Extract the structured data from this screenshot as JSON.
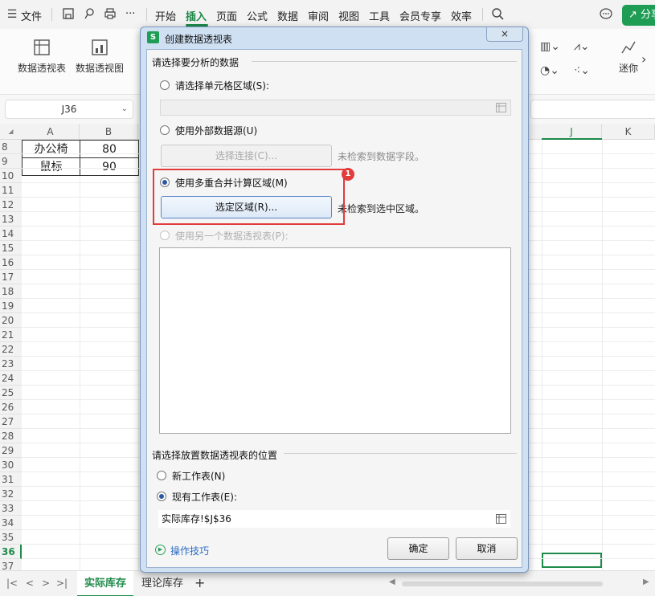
{
  "menubar": {
    "file_label": "文件",
    "more_label": "···",
    "tabs": [
      "开始",
      "插入",
      "页面",
      "公式",
      "数据",
      "审阅",
      "视图",
      "工具",
      "会员专享",
      "效率"
    ],
    "share_label": "分享"
  },
  "ribbon": {
    "pivot_table_label": "数据透视表",
    "pivot_chart_label": "数据透视图",
    "sparkline_label": "迷你"
  },
  "namebox": {
    "value": "J36"
  },
  "grid": {
    "columns": [
      "A",
      "B",
      "J",
      "K"
    ],
    "rows": [
      "8",
      "9",
      "10",
      "11",
      "12",
      "13",
      "14",
      "15",
      "16",
      "17",
      "18",
      "19",
      "20",
      "21",
      "22",
      "23",
      "24",
      "25",
      "26",
      "27",
      "28",
      "29",
      "30",
      "31",
      "32",
      "33",
      "34",
      "35",
      "36",
      "37"
    ],
    "cells": [
      {
        "a": "办公椅",
        "b": "80"
      },
      {
        "a": "鼠标",
        "b": "90"
      }
    ],
    "active_row": "36"
  },
  "sheet_tabs": {
    "active": "实际库存",
    "other": "理论库存",
    "add": "+"
  },
  "dialog": {
    "title": "创建数据透视表",
    "app_icon_letter": "S",
    "close_label": "×",
    "section_source": "请选择要分析的数据",
    "opt_cell_range": "请选择单元格区域(S):",
    "opt_external": "使用外部数据源(U)",
    "btn_choose_connection": "选择连接(C)...",
    "note_no_fields": "未检索到数据字段。",
    "opt_multi_range": "使用多重合并计算区域(M)",
    "btn_select_range": "选定区域(R)...",
    "note_no_range": "未检索到选中区域。",
    "opt_other_pivot": "使用另一个数据透视表(P):",
    "section_location": "请选择放置数据透视表的位置",
    "opt_new_sheet": "新工作表(N)",
    "opt_existing_sheet": "现有工作表(E):",
    "existing_sheet_value": "实际库存!$J$36",
    "tips_label": "操作技巧",
    "btn_ok": "确定",
    "btn_cancel": "取消"
  },
  "annotation": {
    "badge": "1"
  },
  "colors": {
    "accent": "#1e8a4a",
    "highlight": "#e23b3b",
    "link": "#2b6cc4"
  }
}
